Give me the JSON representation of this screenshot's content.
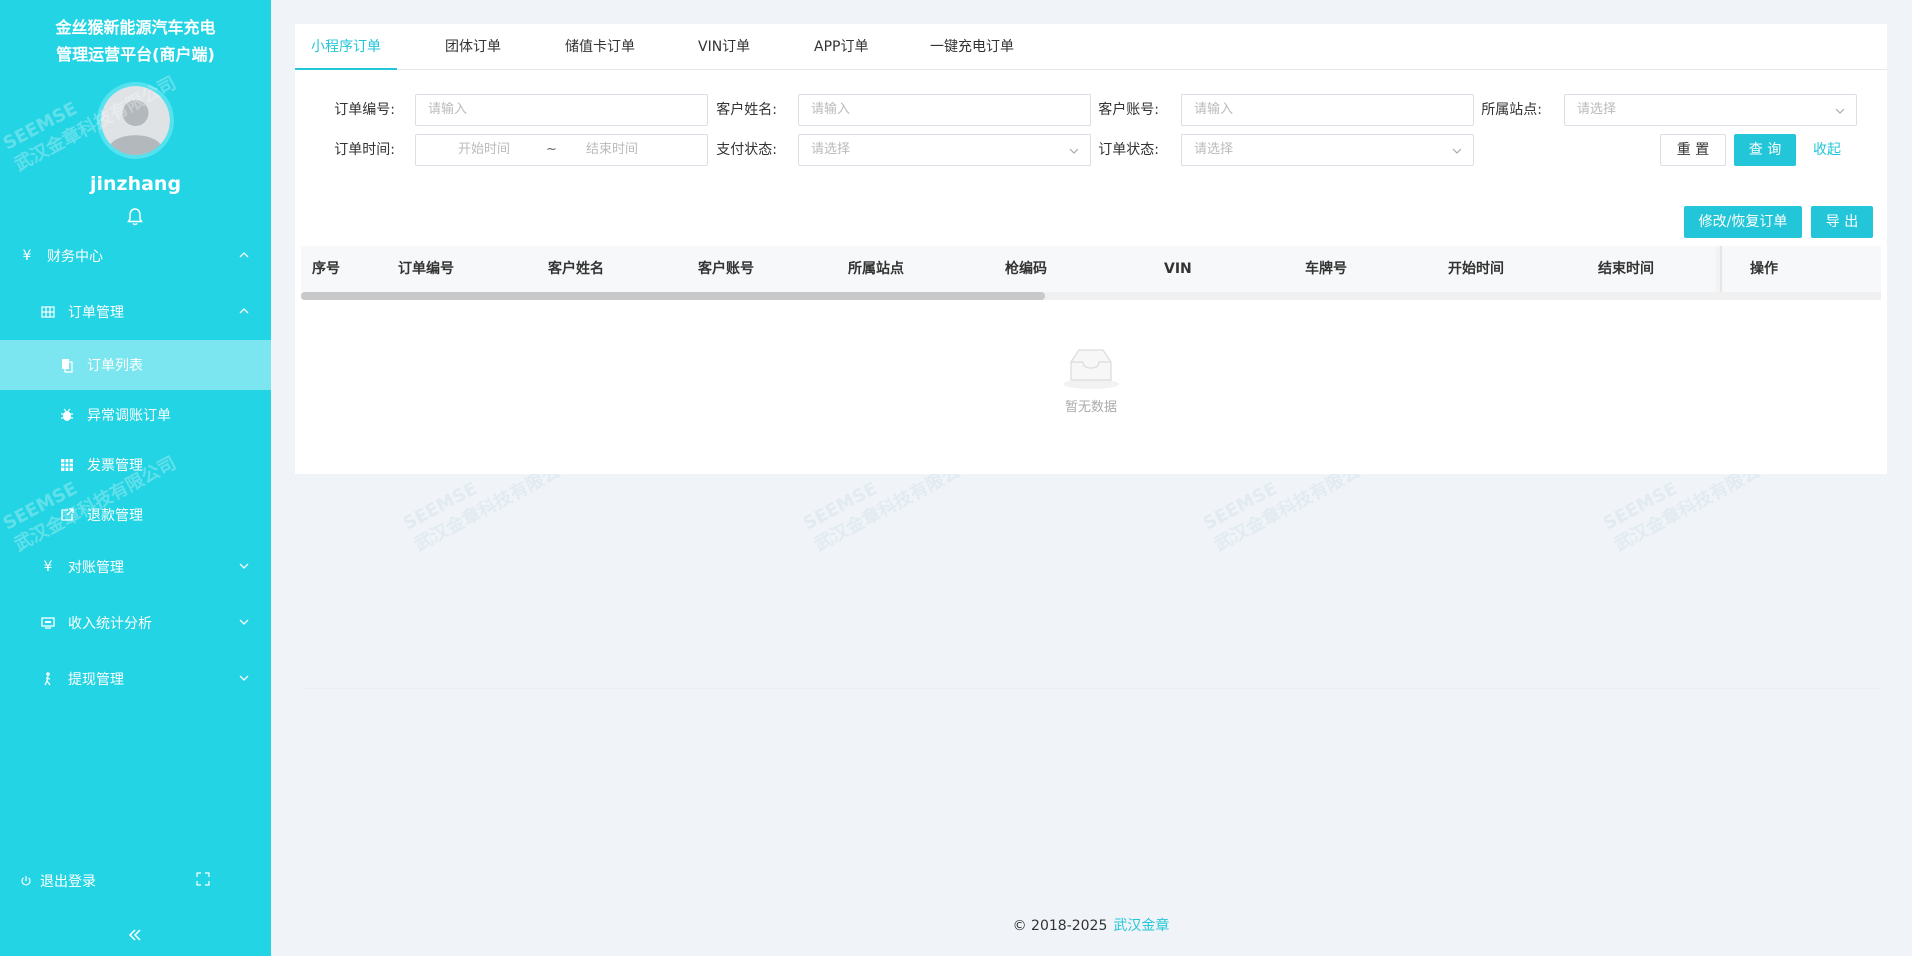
{
  "brand": {
    "line1": "金丝猴新能源汽车充电",
    "line2": "管理运营平台(商户端)"
  },
  "user": {
    "name": "jinzhang"
  },
  "watermark": {
    "logo": "SEEMSE",
    "company": "武汉金章科技有限公司"
  },
  "sidebar": {
    "finance": {
      "label": "财务中心"
    },
    "order_mgmt": {
      "label": "订单管理"
    },
    "order_list": {
      "label": "订单列表"
    },
    "abnormal": {
      "label": "异常调账订单"
    },
    "invoice": {
      "label": "发票管理"
    },
    "refund": {
      "label": "退款管理"
    },
    "reconcile": {
      "label": "对账管理"
    },
    "income": {
      "label": "收入统计分析"
    },
    "withdraw": {
      "label": "提现管理"
    },
    "logout": {
      "label": "退出登录"
    }
  },
  "tabs": [
    "小程序订单",
    "团体订单",
    "储值卡订单",
    "VIN订单",
    "APP订单",
    "一键充电订单"
  ],
  "filters": {
    "order_no": {
      "label": "订单编号:",
      "placeholder": "请输入"
    },
    "customer_name": {
      "label": "客户姓名:",
      "placeholder": "请输入"
    },
    "customer_account": {
      "label": "客户账号:",
      "placeholder": "请输入"
    },
    "station": {
      "label": "所属站点:",
      "placeholder": "请选择"
    },
    "order_time": {
      "label": "订单时间:",
      "start": "开始时间",
      "sep": "~",
      "end": "结束时间"
    },
    "pay_status": {
      "label": "支付状态:",
      "placeholder": "请选择"
    },
    "order_status": {
      "label": "订单状态:",
      "placeholder": "请选择"
    }
  },
  "buttons": {
    "reset": "重 置",
    "query": "查 询",
    "collapse": "收起",
    "modify": "修改/恢复订单",
    "export": "导 出"
  },
  "table": {
    "columns": [
      "序号",
      "订单编号",
      "客户姓名",
      "客户账号",
      "所属站点",
      "枪编码",
      "VIN",
      "车牌号",
      "开始时间",
      "结束时间",
      "操作"
    ],
    "empty_text": "暂无数据"
  },
  "footer": {
    "copyright": "© 2018-2025",
    "company": "武汉金章"
  },
  "colors": {
    "primary": "#23c6d8",
    "sidebar": "#23d4e4",
    "sidebar_active": "#7be6ef"
  }
}
